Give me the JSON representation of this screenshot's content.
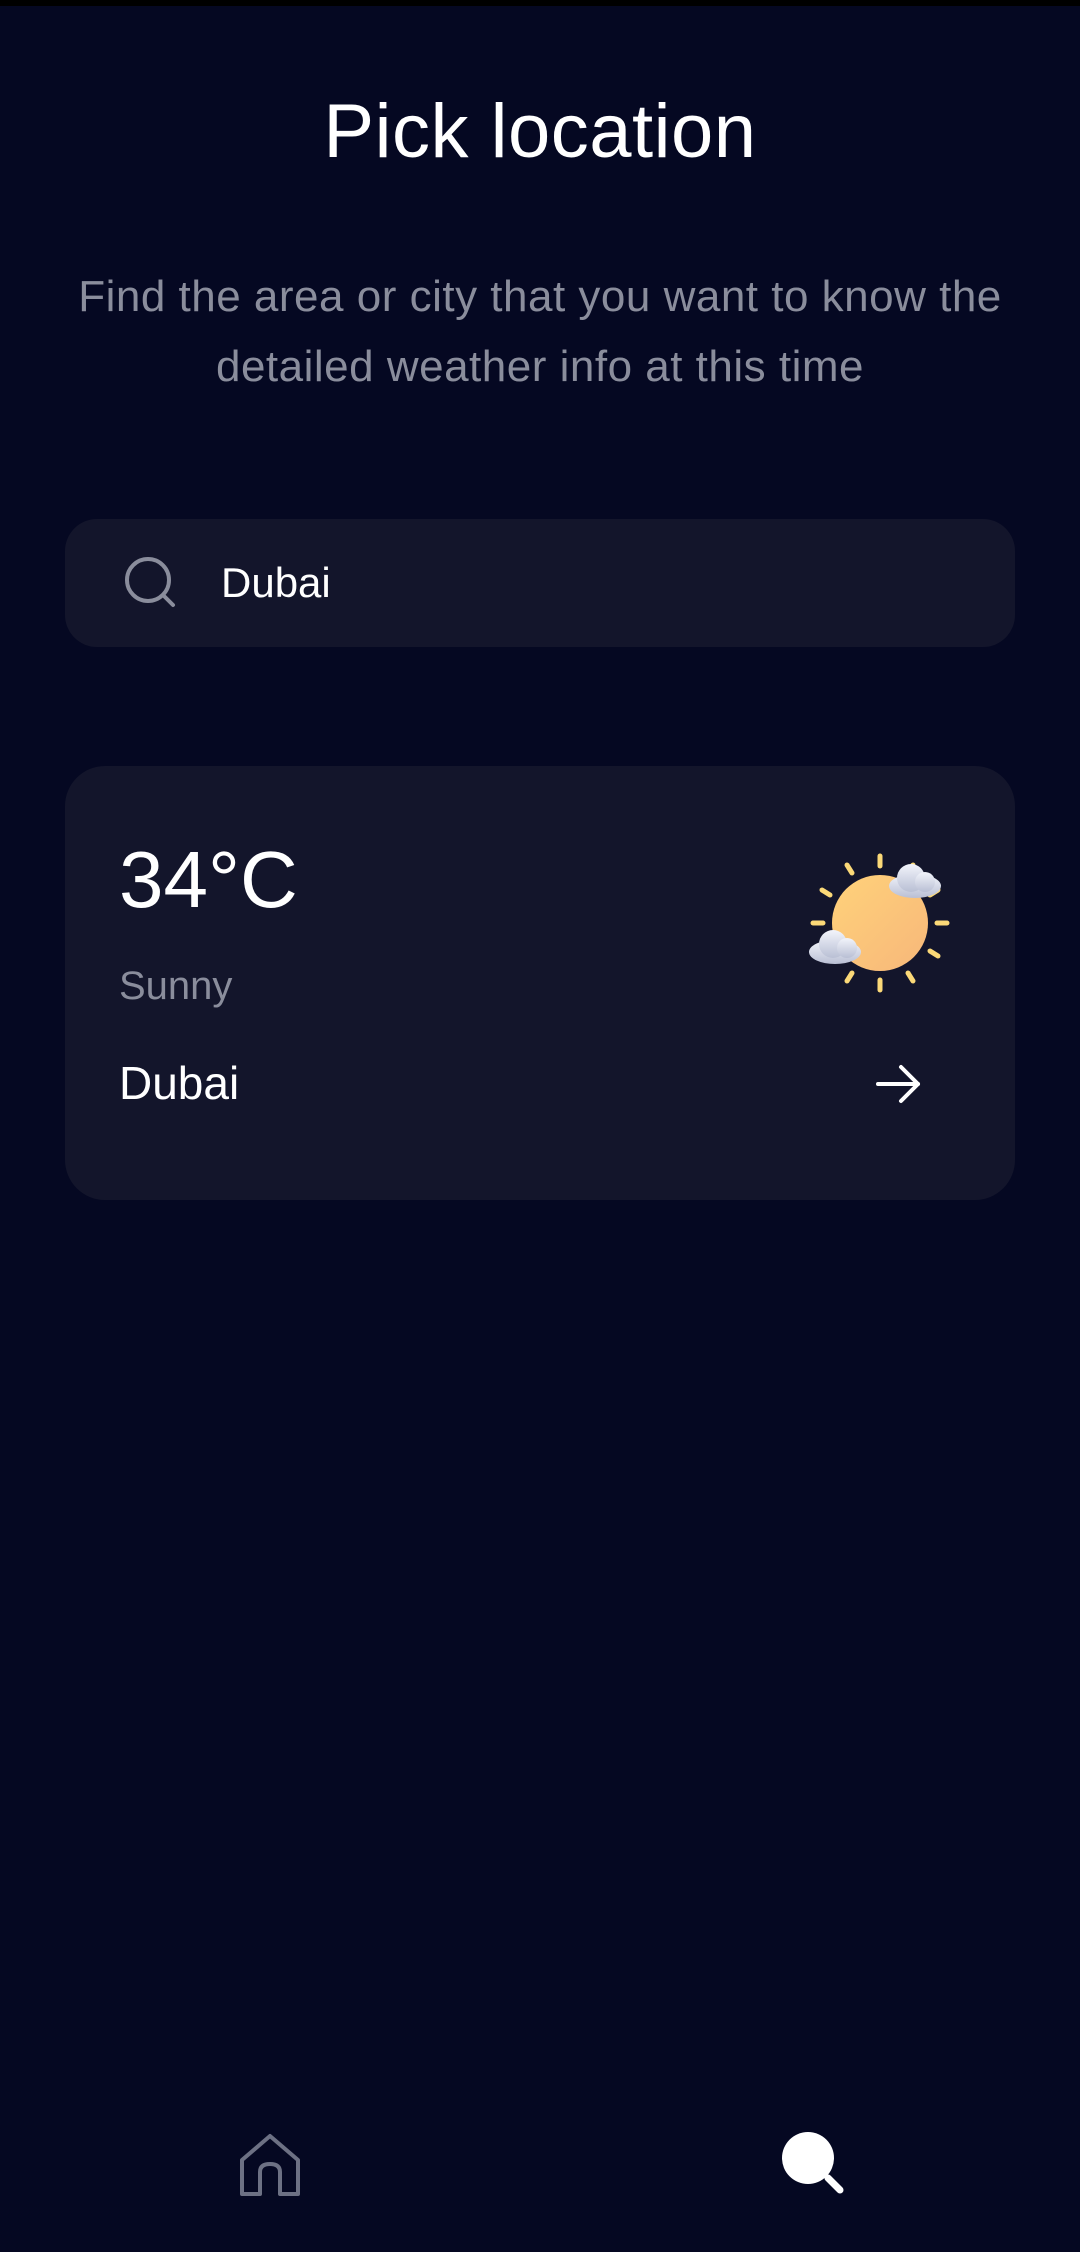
{
  "header": {
    "title": "Pick location",
    "subtitle": "Find the area or city that you want to know the detailed weather info at this time"
  },
  "search": {
    "value": "Dubai",
    "icon": "search-icon"
  },
  "result_card": {
    "temperature": "34°C",
    "condition": "Sunny",
    "city": "Dubai",
    "weather_icon": "sun-with-clouds-icon",
    "action_icon": "arrow-right-icon"
  },
  "bottom_nav": {
    "items": [
      {
        "icon": "home-icon",
        "active": false
      },
      {
        "icon": "search-icon",
        "active": true
      }
    ]
  },
  "colors": {
    "background": "#050822",
    "card": "#13152b",
    "muted_text": "#8a8d9c",
    "text": "#ffffff",
    "sun": "#fcc77a"
  }
}
